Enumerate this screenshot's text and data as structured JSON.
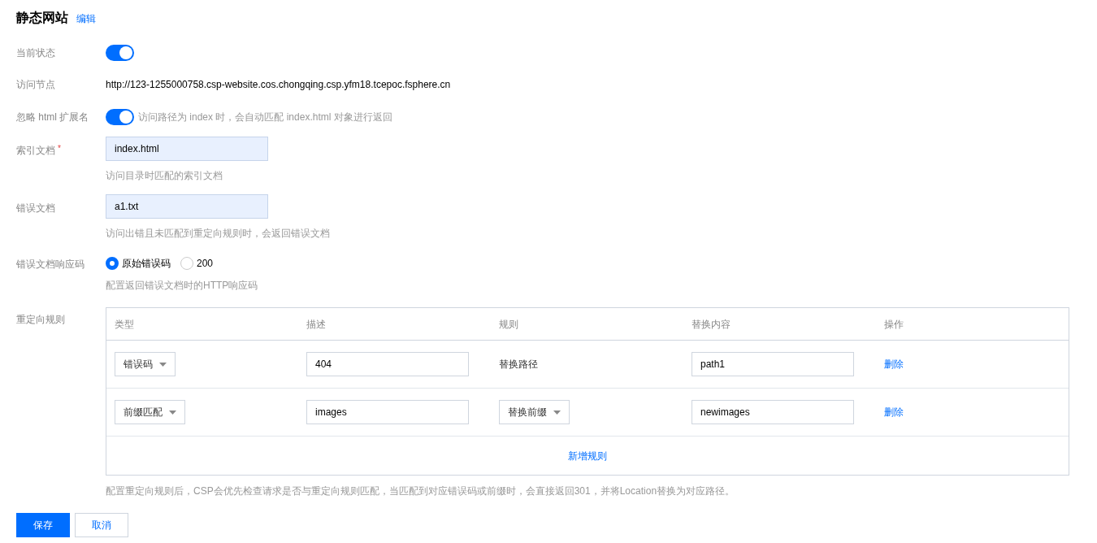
{
  "title": "静态网站",
  "edit_link": "编辑",
  "status": {
    "label": "当前状态",
    "on": true
  },
  "endpoint": {
    "label": "访问节点",
    "value": "http://123-1255000758.csp-website.cos.chongqing.csp.yfm18.tcepoc.fsphere.cn"
  },
  "ignore_html": {
    "label": "忽略 html 扩展名",
    "on": true,
    "hint": "访问路径为 index 时，会自动匹配 index.html 对象进行返回"
  },
  "index_doc": {
    "label": "索引文档",
    "required_mark": "*",
    "value": "index.html",
    "hint": "访问目录时匹配的索引文档"
  },
  "error_doc": {
    "label": "错误文档",
    "value": "a1.txt",
    "hint": "访问出错且未匹配到重定向规则时，会返回错误文档"
  },
  "error_code": {
    "label": "错误文档响应码",
    "options": [
      {
        "label": "原始错误码",
        "selected": true
      },
      {
        "label": "200",
        "selected": false
      }
    ],
    "hint": "配置返回错误文档时的HTTP响应码"
  },
  "redirect": {
    "label": "重定向规则",
    "columns": [
      "类型",
      "描述",
      "规则",
      "替换内容",
      "操作"
    ],
    "rows": [
      {
        "type": "错误码",
        "description": "404",
        "rule": {
          "kind": "text",
          "text": "替换路径"
        },
        "replacement": "path1",
        "action": "删除"
      },
      {
        "type": "前缀匹配",
        "description": "images",
        "rule": {
          "kind": "select",
          "text": "替换前缀"
        },
        "replacement": "newimages",
        "action": "删除"
      }
    ],
    "add_label": "新增规则",
    "note": "配置重定向规则后，CSP会优先检查请求是否与重定向规则匹配，当匹配到对应错误码或前缀时，会直接返回301，并将Location替换为对应路径。"
  },
  "buttons": [
    {
      "label": "保存",
      "kind": "primary"
    },
    {
      "label": "取消",
      "kind": "default"
    }
  ]
}
